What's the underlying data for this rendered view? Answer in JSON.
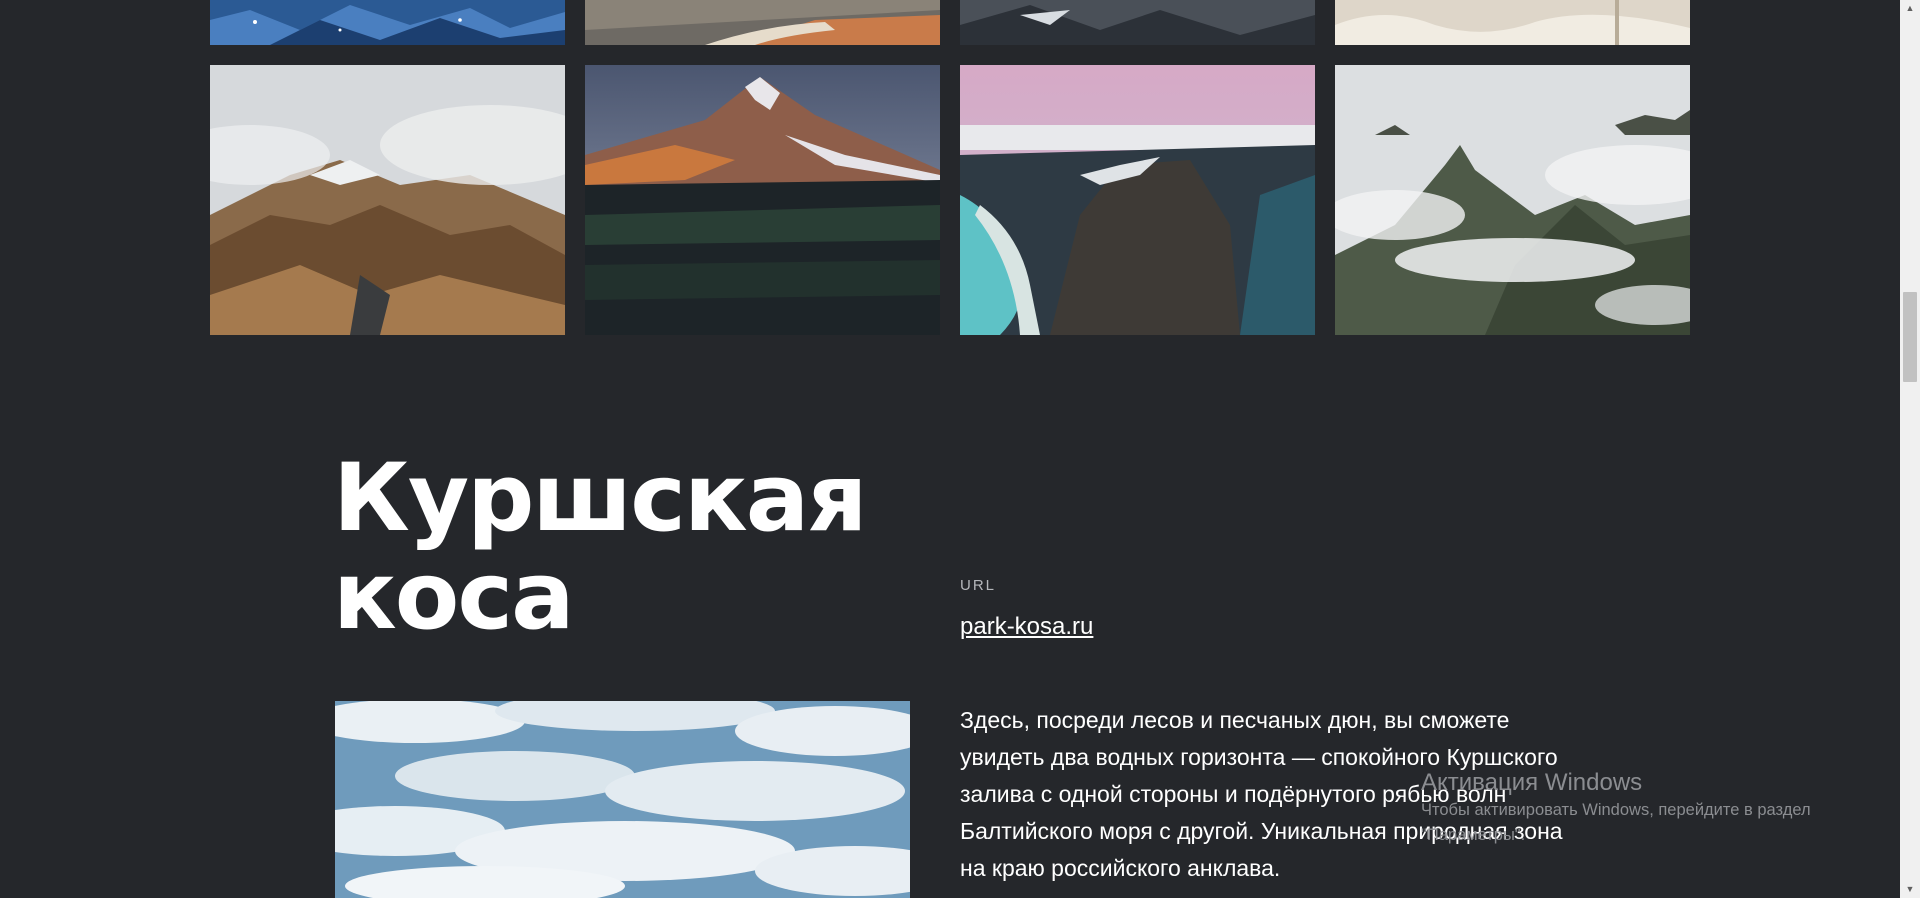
{
  "gallery": {
    "photos_top_row": [
      {
        "name": "photo-ice"
      },
      {
        "name": "photo-beach"
      },
      {
        "name": "photo-rocky-ridge"
      },
      {
        "name": "photo-white-rocks"
      }
    ],
    "photos_bottom_row": [
      {
        "name": "photo-misty-hills"
      },
      {
        "name": "photo-volcano"
      },
      {
        "name": "photo-coastal-cliff"
      },
      {
        "name": "photo-cloud-peaks"
      }
    ]
  },
  "section": {
    "title_line1": "Куршская",
    "title_line2": "коса",
    "url_label": "URL",
    "url_text": "park-kosa.ru",
    "description": "Здесь, посреди лесов и песчаных дюн, вы сможете увидеть два водных горизонта — спокойного Куршского залива с одной стороны и подёрнутого рябью волн Балтийского моря с другой. Уникальная природная зона на краю российского анклава."
  },
  "watermark": {
    "title": "Активация Windows",
    "line1": "Чтобы активировать Windows, перейдите в раздел",
    "line2": "\"Параметры\"."
  },
  "scrollbar": {
    "up_icon": "arrow-up-icon",
    "down_icon": "arrow-down-icon"
  }
}
